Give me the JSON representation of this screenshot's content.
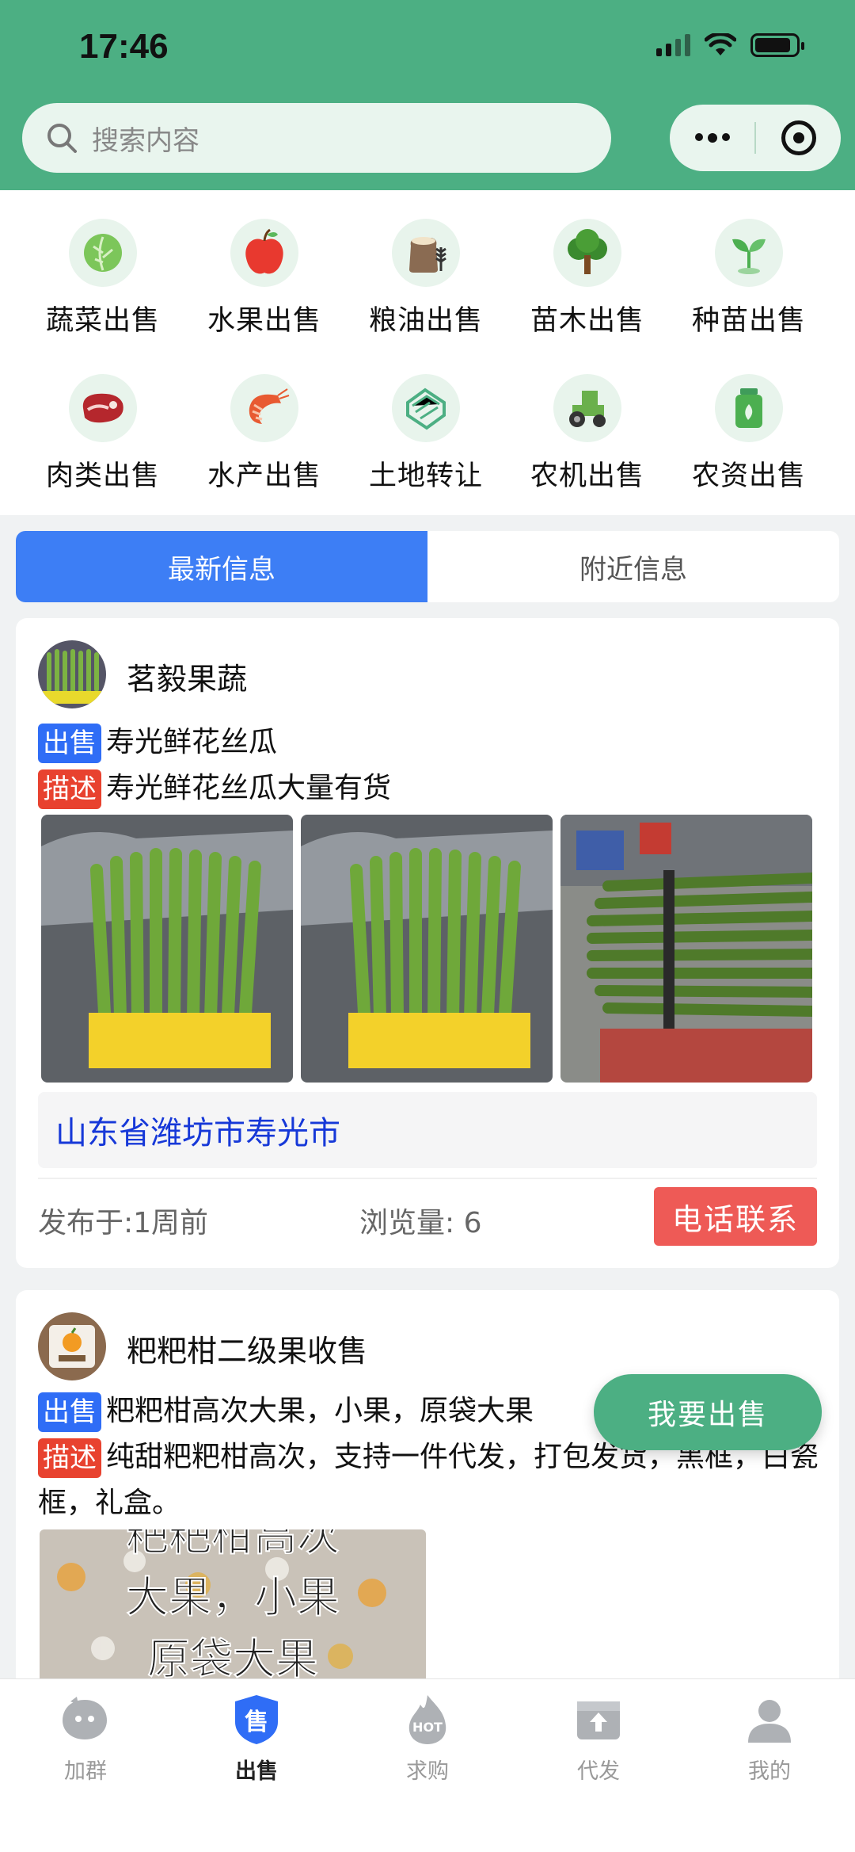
{
  "status_bar": {
    "time": "17:46"
  },
  "search": {
    "placeholder": "搜索内容"
  },
  "categories": [
    {
      "label": "蔬菜出售",
      "icon": "cabbage-icon"
    },
    {
      "label": "水果出售",
      "icon": "apple-icon"
    },
    {
      "label": "粮油出售",
      "icon": "grain-sack-icon"
    },
    {
      "label": "苗木出售",
      "icon": "tree-icon"
    },
    {
      "label": "种苗出售",
      "icon": "sprout-icon"
    },
    {
      "label": "肉类出售",
      "icon": "meat-icon"
    },
    {
      "label": "水产出售",
      "icon": "shrimp-icon"
    },
    {
      "label": "土地转让",
      "icon": "land-icon"
    },
    {
      "label": "农机出售",
      "icon": "tractor-icon"
    },
    {
      "label": "农资出售",
      "icon": "fertilizer-icon"
    }
  ],
  "tabs": [
    {
      "label": "最新信息",
      "active": true
    },
    {
      "label": "附近信息",
      "active": false
    }
  ],
  "posts": [
    {
      "shop": "茗毅果蔬",
      "sell_tag": "出售",
      "sell_text": "寿光鲜花丝瓜",
      "desc_tag": "描述",
      "desc_text": "寿光鲜花丝瓜大量有货",
      "location": "山东省潍坊市寿光市",
      "posted": "发布于:1周前",
      "views": "浏览量: 6",
      "call_label": "电话联系"
    },
    {
      "shop": "粑粑柑二级果收售",
      "sell_tag": "出售",
      "sell_text": "粑粑柑高次大果，小果，原袋大果",
      "desc_tag": "描述",
      "desc_text": "纯甜粑粑柑高次，支持一件代发，打包发货，黑框，白瓷框，礼盒。",
      "video_caption_1": "粑粑柑高次",
      "video_caption_2": "大果，小果",
      "video_caption_3": "原袋大果"
    }
  ],
  "fab": {
    "label": "我要出售"
  },
  "bottom_nav": [
    {
      "label": "加群",
      "icon": "group-chat-icon",
      "active": false
    },
    {
      "label": "出售",
      "icon": "sell-shield-icon",
      "active": true
    },
    {
      "label": "求购",
      "icon": "hot-flame-icon",
      "active": false
    },
    {
      "label": "代发",
      "icon": "upload-box-icon",
      "active": false
    },
    {
      "label": "我的",
      "icon": "user-icon",
      "active": false
    }
  ],
  "colors": {
    "brand_green": "#4caf83",
    "tab_blue": "#3d7ef5",
    "tag_blue": "#2f6df6",
    "tag_red": "#e8422f",
    "call_red": "#ee5a56"
  }
}
